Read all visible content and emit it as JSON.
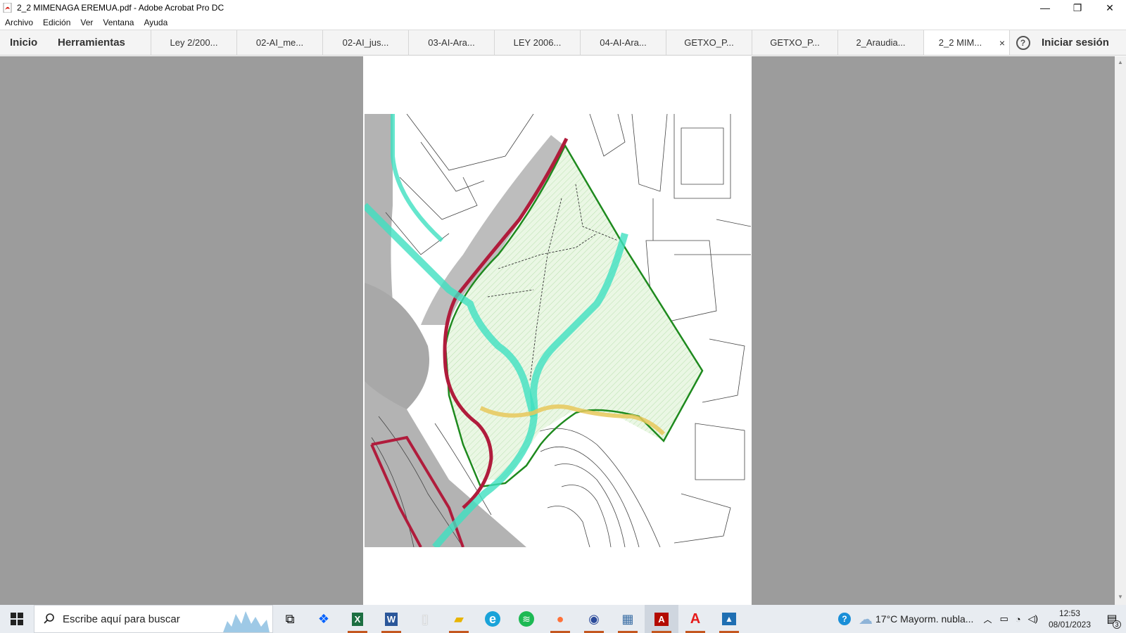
{
  "window": {
    "title": "2_2 MIMENAGA EREMUA.pdf - Adobe Acrobat Pro DC",
    "minimize_glyph": "—",
    "restore_glyph": "❐",
    "close_glyph": "✕"
  },
  "menu": [
    "Archivo",
    "Edición",
    "Ver",
    "Ventana",
    "Ayuda"
  ],
  "nav": {
    "home": "Inicio",
    "tools": "Herramientas"
  },
  "tabs": [
    {
      "label": "Ley 2/200..."
    },
    {
      "label": "02-AI_me..."
    },
    {
      "label": "02-AI_jus..."
    },
    {
      "label": "03-AI-Ara..."
    },
    {
      "label": "LEY 2006..."
    },
    {
      "label": "04-AI-Ara..."
    },
    {
      "label": "GETXO_P..."
    },
    {
      "label": "GETXO_P..."
    },
    {
      "label": "2_Araudia..."
    },
    {
      "label": "2_2 MIM...",
      "active": true
    }
  ],
  "tab_close": "×",
  "help": "?",
  "signin": "Iniciar sesión",
  "colors": {
    "viewer_bg": "#9c9c9c",
    "boundary_green": "#1e8a1e",
    "road_red": "#b01c3c",
    "river_cyan": "#3fe0c0",
    "path_yellow": "#e8c85a"
  },
  "taskbar": {
    "search_placeholder": "Escribe aquí para buscar",
    "apps": [
      {
        "name": "task-view-icon",
        "glyph": "⧉"
      },
      {
        "name": "dropbox-icon",
        "glyph": "❖"
      },
      {
        "name": "excel-icon",
        "glyph": "X"
      },
      {
        "name": "word-icon",
        "glyph": "W"
      },
      {
        "name": "notepad-icon",
        "glyph": "▯"
      },
      {
        "name": "file-explorer-icon",
        "glyph": "▰"
      },
      {
        "name": "edge-icon",
        "glyph": "e"
      },
      {
        "name": "spotify-icon",
        "glyph": "≋"
      },
      {
        "name": "firefox-icon",
        "glyph": "●"
      },
      {
        "name": "globe-app-icon",
        "glyph": "◉"
      },
      {
        "name": "calculator-icon",
        "glyph": "▦"
      },
      {
        "name": "acrobat-icon",
        "glyph": "A"
      },
      {
        "name": "autocad-icon",
        "glyph": "A"
      },
      {
        "name": "photos-icon",
        "glyph": "▲"
      }
    ],
    "weather": "17°C  Mayorm. nubla...",
    "time": "12:53",
    "date": "08/01/2023",
    "notifications": "3"
  }
}
